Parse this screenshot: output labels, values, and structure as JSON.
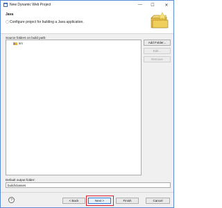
{
  "window": {
    "title": "New Dynamic Web Project",
    "minimize_glyph": "—",
    "maximize_glyph": "☐",
    "close_glyph": "✕"
  },
  "header": {
    "title": "Java",
    "description": "Configure project for building a Java application."
  },
  "source_folders": {
    "label": "Source folders on build path:",
    "items": [
      "src"
    ]
  },
  "side_buttons": {
    "add_folder": "Add Folder...",
    "edit": "Edit...",
    "remove": "Remove"
  },
  "output": {
    "label": "Default output folder:",
    "value": "build\\classes"
  },
  "footer": {
    "help_glyph": "?",
    "back": "< Back",
    "next": "Next >",
    "finish": "Finish",
    "cancel": "Cancel"
  },
  "colors": {
    "highlight": "#e0202a",
    "primary_border": "#2c7ad6"
  }
}
